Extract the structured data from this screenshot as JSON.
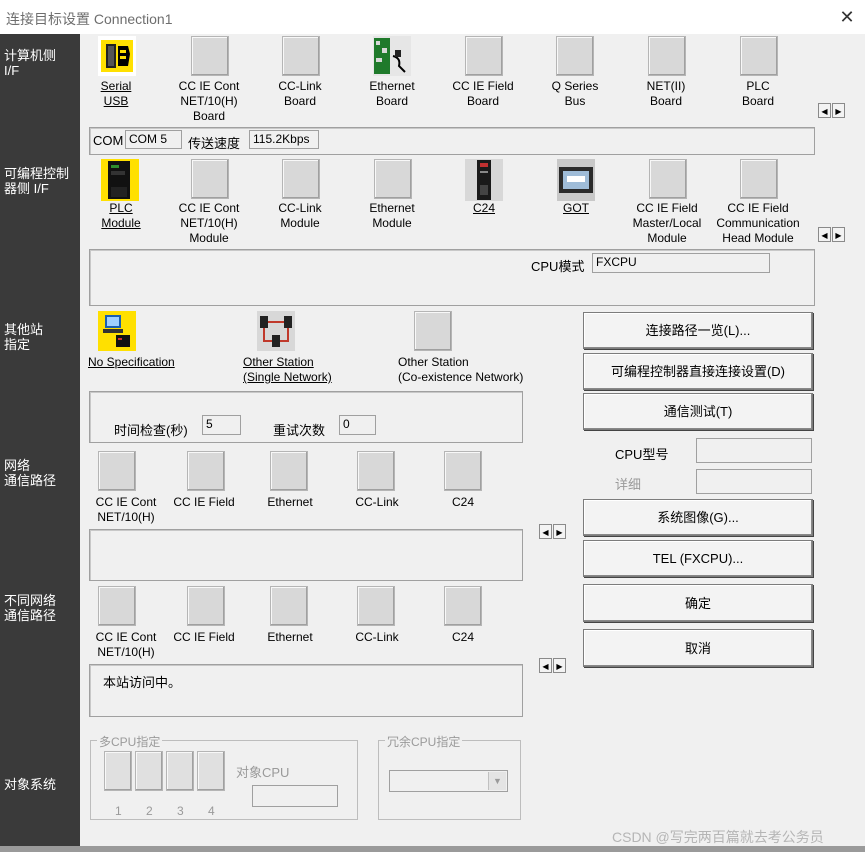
{
  "window": {
    "title": "连接目标设置 Connection1",
    "close_glyph": "✕"
  },
  "sidebar": {
    "pc_if": "计算机侧\nI/F",
    "plc_if": "可编程控制\n器侧 I/F",
    "other_station": "其他站\n指定",
    "network_route": "网络\n通信路径",
    "diff_network_route": "不同网络\n通信路径",
    "target_system": "对象系统"
  },
  "pc_side": {
    "items": [
      {
        "label": "Serial\nUSB",
        "icon": "serial-usb-icon"
      },
      {
        "label": "CC IE Cont\nNET/10(H)\nBoard",
        "icon": "blank-icon"
      },
      {
        "label": "CC-Link\nBoard",
        "icon": "blank-icon"
      },
      {
        "label": "Ethernet\nBoard",
        "icon": "ethernet-board-icon"
      },
      {
        "label": "CC IE Field\nBoard",
        "icon": "blank-icon"
      },
      {
        "label": "Q Series\nBus",
        "icon": "blank-icon"
      },
      {
        "label": "NET(II)\nBoard",
        "icon": "blank-icon"
      },
      {
        "label": "PLC\nBoard",
        "icon": "blank-icon"
      }
    ],
    "com_label": "COM",
    "com_value": "COM 5",
    "speed_label": "传送速度",
    "speed_value": "115.2Kbps"
  },
  "plc_side": {
    "items": [
      {
        "label": "PLC\nModule",
        "icon": "plc-module-icon"
      },
      {
        "label": "CC IE Cont\nNET/10(H)\nModule",
        "icon": "blank-icon"
      },
      {
        "label": "CC-Link\nModule",
        "icon": "blank-icon"
      },
      {
        "label": "Ethernet\nModule",
        "icon": "blank-icon"
      },
      {
        "label": "C24",
        "icon": "c24-icon"
      },
      {
        "label": "GOT",
        "icon": "got-icon"
      },
      {
        "label": "CC IE Field\nMaster/Local\nModule",
        "icon": "blank-icon"
      },
      {
        "label": "CC IE Field\nCommunication\nHead Module",
        "icon": "blank-icon"
      }
    ],
    "cpu_mode_label": "CPU模式",
    "cpu_mode_value": "FXCPU"
  },
  "other_station": {
    "items": [
      {
        "label": "No Specification",
        "icon": "no-specification-icon"
      },
      {
        "label": "Other Station\n(Single Network)",
        "icon": "single-network-icon"
      },
      {
        "label": "Other Station\n(Co-existence Network)",
        "icon": "blank-icon"
      }
    ],
    "time_check_label": "时间检查(秒)",
    "time_check_value": "5",
    "retry_label": "重试次数",
    "retry_value": "0"
  },
  "network_route": {
    "items": [
      {
        "label": "CC IE Cont\nNET/10(H)"
      },
      {
        "label": "CC IE Field"
      },
      {
        "label": "Ethernet"
      },
      {
        "label": "CC-Link"
      },
      {
        "label": "C24"
      }
    ]
  },
  "diff_network_route": {
    "items": [
      {
        "label": "CC IE Cont\nNET/10(H)"
      },
      {
        "label": "CC IE Field"
      },
      {
        "label": "Ethernet"
      },
      {
        "label": "CC-Link"
      },
      {
        "label": "C24"
      }
    ],
    "status_text": "本站访问中。"
  },
  "buttons": {
    "route_list": "连接路径一览(L)...",
    "direct_connect": "可编程控制器直接连接设置(D)",
    "comm_test": "通信测试(T)",
    "system_image": "系统图像(G)...",
    "tel": "TEL (FXCPU)...",
    "ok": "确定",
    "cancel": "取消"
  },
  "cpu_info": {
    "model_label": "CPU型号",
    "detail_label": "详细",
    "model_value": "",
    "detail_value": ""
  },
  "multi_cpu": {
    "title": "多CPU指定",
    "target_label": "对象CPU",
    "slots": [
      "1",
      "2",
      "3",
      "4"
    ]
  },
  "redundant_cpu": {
    "title": "冗余CPU指定"
  },
  "watermark": "CSDN @写完两百篇就去考公务员"
}
